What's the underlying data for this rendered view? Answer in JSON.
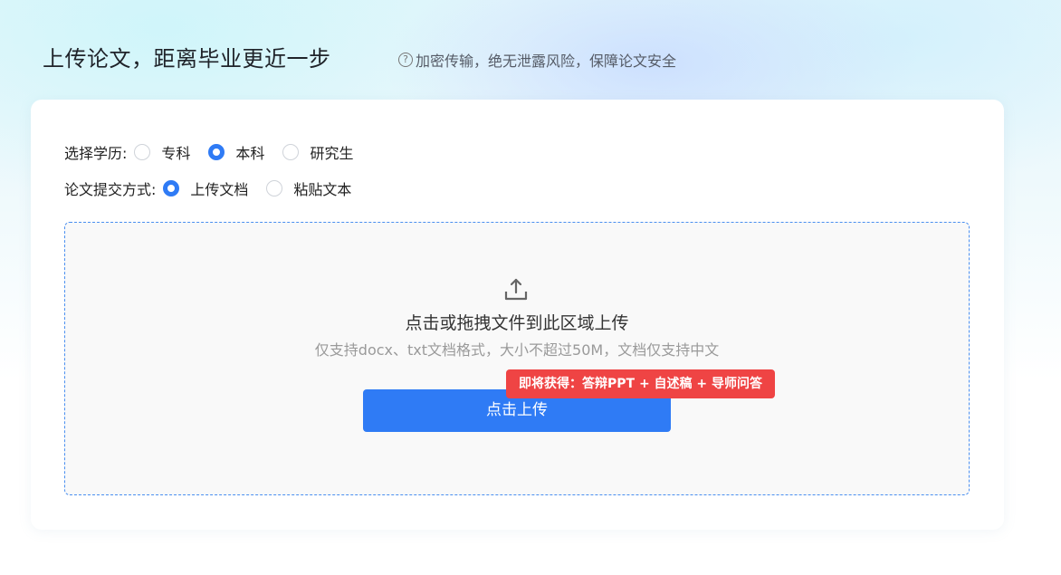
{
  "header": {
    "title": "上传论文，距离毕业更近一步",
    "security_note": "加密传输，绝无泄露风险，保障论文安全"
  },
  "form": {
    "education": {
      "label": "选择学历:",
      "options": [
        "专科",
        "本科",
        "研究生"
      ],
      "selected": "本科"
    },
    "submit_method": {
      "label": "论文提交方式:",
      "options": [
        "上传文档",
        "粘贴文本"
      ],
      "selected": "上传文档"
    }
  },
  "upload": {
    "title": "点击或拖拽文件到此区域上传",
    "hint": "仅支持docx、txt文档格式，大小不超过50M，文档仅支持中文",
    "button_label": "点击上传",
    "promo": "即将获得：答辩PPT + 自述稿 + 导师问答"
  },
  "colors": {
    "accent": "#2f7bf5",
    "promo": "#ef4444"
  },
  "icons": {
    "help": "question-circle-icon",
    "upload": "upload-tray-icon"
  }
}
